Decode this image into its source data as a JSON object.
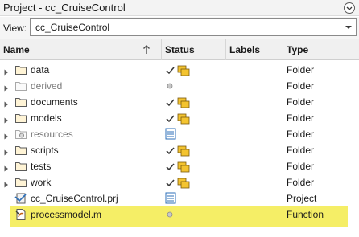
{
  "window": {
    "title": "Project - cc_CruiseControl"
  },
  "view": {
    "label": "View:",
    "selected": "cc_CruiseControl"
  },
  "columns": {
    "name": "Name",
    "status": "Status",
    "labels": "Labels",
    "type": "Type"
  },
  "rows": [
    {
      "name": "data",
      "type": "Folder",
      "status_icon": "check-folder-icon",
      "icon": "folder-icon",
      "dim": false,
      "expandable": true
    },
    {
      "name": "derived",
      "type": "Folder",
      "status_icon": "dot-icon",
      "icon": "folder-faded-icon",
      "dim": true,
      "expandable": true
    },
    {
      "name": "documents",
      "type": "Folder",
      "status_icon": "check-folder-icon",
      "icon": "folder-icon",
      "dim": false,
      "expandable": true
    },
    {
      "name": "models",
      "type": "Folder",
      "status_icon": "check-folder-icon",
      "icon": "folder-icon",
      "dim": false,
      "expandable": true
    },
    {
      "name": "resources",
      "type": "Folder",
      "status_icon": "project-resource-icon",
      "icon": "folder-gear-icon",
      "dim": true,
      "expandable": true
    },
    {
      "name": "scripts",
      "type": "Folder",
      "status_icon": "check-folder-icon",
      "icon": "folder-icon",
      "dim": false,
      "expandable": true
    },
    {
      "name": "tests",
      "type": "Folder",
      "status_icon": "check-folder-icon",
      "icon": "folder-icon",
      "dim": false,
      "expandable": true
    },
    {
      "name": "work",
      "type": "Folder",
      "status_icon": "check-folder-icon",
      "icon": "folder-icon",
      "dim": false,
      "expandable": true
    },
    {
      "name": "cc_CruiseControl.prj",
      "type": "Project",
      "status_icon": "project-resource-icon",
      "icon": "prj-file-icon",
      "dim": false,
      "expandable": false
    },
    {
      "name": "processmodel.m",
      "type": "Function",
      "status_icon": "dot-icon",
      "icon": "mfile-icon",
      "dim": false,
      "expandable": false,
      "highlighted": true
    }
  ],
  "colors": {
    "highlight": "#f5ee66",
    "folder": "#e8b84a",
    "check": "#3a3a3a"
  }
}
